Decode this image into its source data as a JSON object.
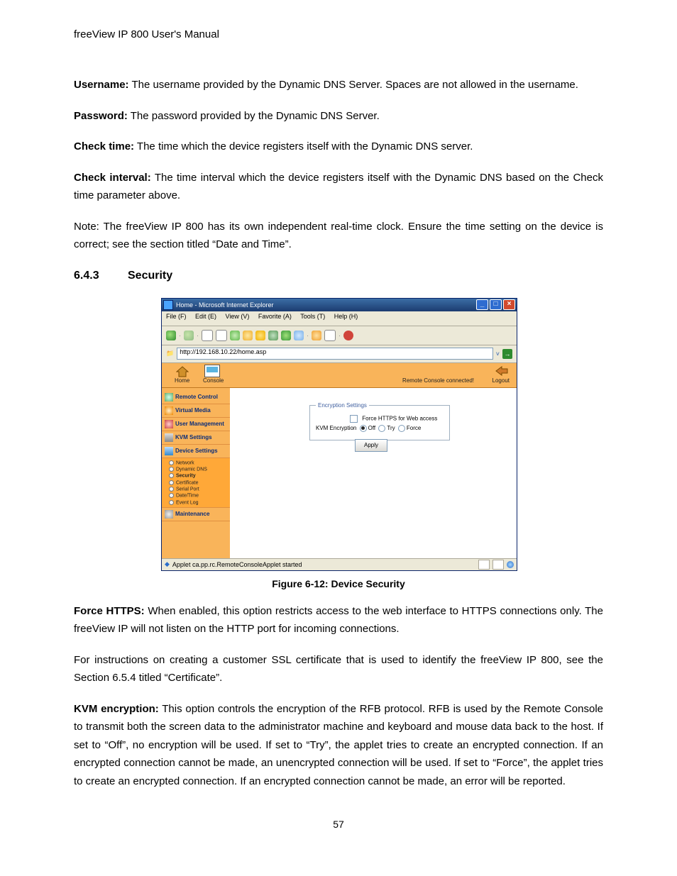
{
  "header": "freeView IP 800 User's Manual",
  "p1": {
    "label": "Username:",
    "text": " The username provided by the Dynamic DNS Server. Spaces are not allowed in the username."
  },
  "p2": {
    "label": "Password:",
    "text": " The password provided by the Dynamic DNS Server."
  },
  "p3": {
    "label": "Check time:",
    "text": " The time which the device registers itself with the Dynamic DNS server."
  },
  "p4": {
    "label": "Check interval:",
    "text": " The time interval which the device registers itself with the Dynamic DNS based on the Check time parameter above."
  },
  "p5": "Note: The freeView IP 800 has its own independent real-time clock. Ensure the time setting on the device is correct; see the section titled “Date and Time”.",
  "section": {
    "num": "6.4.3",
    "title": "Security"
  },
  "caption": "Figure 6-12: Device Security",
  "p6": {
    "label": "Force HTTPS:",
    "text": " When enabled, this option restricts access to the web interface to HTTPS connections only. The freeView IP will not listen on the HTTP port for incoming connections."
  },
  "p7": "For instructions on creating a customer SSL certificate that is used to identify the freeView IP 800, see the Section 6.5.4 titled “Certificate”.",
  "p8": {
    "label": "KVM encryption:",
    "text": " This option controls the encryption of the RFB protocol. RFB is used by the Remote Console to transmit both the screen data to the administrator machine and keyboard and mouse data back to the host. If set to “Off”, no encryption will be used. If set to “Try”, the applet tries to create an encrypted connection. If an encrypted connection cannot be made, an unencrypted connection will be used. If set to “Force”, the applet tries to create an encrypted connection. If an encrypted connection cannot be made, an error will be reported."
  },
  "pagenum": "57",
  "ie": {
    "title": "Home - Microsoft Internet Explorer",
    "menu": {
      "file": "File (F)",
      "edit": "Edit (E)",
      "view": "View (V)",
      "fav": "Favorite (A)",
      "tools": "Tools (T)",
      "help": "Help (H)"
    },
    "addr": "http://192.168.10.22/home.asp",
    "status": "Applet ca.pp.rc.RemoteConsoleApplet started"
  },
  "app": {
    "home": "Home",
    "console": "Console",
    "status": "Remote Console connected!",
    "logout": "Logout",
    "sidebar": {
      "rc": "Remote Control",
      "vm": "Virtual Media",
      "um": "User Management",
      "kvm": "KVM Settings",
      "ds": "Device Settings",
      "mt": "Maintenance",
      "subs": {
        "net": "Network",
        "dns": "Dynamic DNS",
        "sec": "Security",
        "cert": "Certificate",
        "ser": "Serial Port",
        "dt": "Date/Time",
        "ev": "Event Log"
      }
    },
    "enc": {
      "legend": "Encryption Settings",
      "force": "Force HTTPS for Web access",
      "kvm": "KVM Encryption",
      "opt_off": "Off",
      "opt_try": "Try",
      "opt_force": "Force",
      "apply": "Apply"
    }
  }
}
